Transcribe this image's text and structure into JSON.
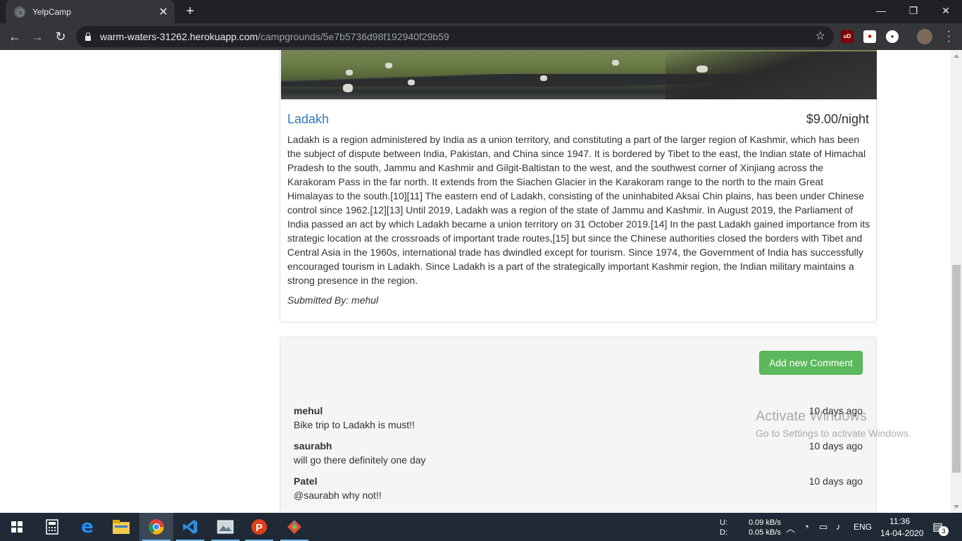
{
  "browser": {
    "tab_title": "YelpCamp",
    "tab_close": "✕",
    "new_tab": "+",
    "url_host": "warm-waters-31262.herokuapp.com",
    "url_path": "/campgrounds/5e7b5736d98f192940f29b59",
    "controls": {
      "minimize": "—",
      "maximize": "❐",
      "close": "✕"
    },
    "extensions": [
      "uBlock",
      "flag",
      "tracker",
      "profile"
    ]
  },
  "campground": {
    "name": "Ladakh",
    "price": "$9.00/night",
    "description": "Ladakh is a region administered by India as a union territory, and constituting a part of the larger region of Kashmir, which has been the subject of dispute between India, Pakistan, and China since 1947. It is bordered by Tibet to the east, the Indian state of Himachal Pradesh to the south, Jammu and Kashmir and Gilgit-Baltistan to the west, and the southwest corner of Xinjiang across the Karakoram Pass in the far north. It extends from the Siachen Glacier in the Karakoram range to the north to the main Great Himalayas to the south.[10][11] The eastern end of Ladakh, consisting of the uninhabited Aksai Chin plains, has been under Chinese control since 1962.[12][13] Until 2019, Ladakh was a region of the state of Jammu and Kashmir. In August 2019, the Parliament of India passed an act by which Ladakh became a union territory on 31 October 2019.[14] In the past Ladakh gained importance from its strategic location at the crossroads of important trade routes,[15] but since the Chinese authorities closed the borders with Tibet and Central Asia in the 1960s, international trade has dwindled except for tourism. Since 1974, the Government of India has successfully encouraged tourism in Ladakh. Since Ladakh is a part of the strategically important Kashmir region, the Indian military maintains a strong presence in the region.",
    "submitted_by": "Submitted By: mehul"
  },
  "comments_section": {
    "add_button": "Add new Comment",
    "comments": [
      {
        "author": "mehul",
        "date": "10 days ago",
        "text": "Bike trip to Ladakh is must!!"
      },
      {
        "author": "saurabh",
        "date": "10 days ago",
        "text": "will go there definitely one day"
      },
      {
        "author": "Patel",
        "date": "10 days ago",
        "text": "@saurabh why not!!"
      }
    ]
  },
  "watermark": {
    "line1": "Activate Windows",
    "line2": "Go to Settings to activate Windows."
  },
  "taskbar": {
    "apps": [
      "start",
      "calculator",
      "edge",
      "file-explorer",
      "chrome",
      "vscode",
      "photos",
      "postman",
      "git"
    ],
    "net_labels": {
      "up_label": "U:",
      "down_label": "D:",
      "up": "0.09 kB/s",
      "down": "0.05 kB/s"
    },
    "language": "ENG",
    "time": "11:36",
    "date": "14-04-2020",
    "notifications": "3"
  }
}
